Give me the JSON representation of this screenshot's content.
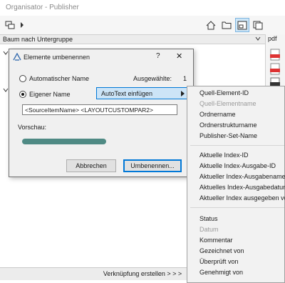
{
  "window": {
    "title": "Organisator - Publisher"
  },
  "toolbar": {
    "icons": [
      "publisher-set-icon",
      "house-icon",
      "folder-icon",
      "layout-icon",
      "copy-icon"
    ]
  },
  "group_bar": {
    "label": "Baum nach Untergruppe",
    "pdf_label": "pdf"
  },
  "bottom_bar": {
    "label": "Verknüpfung erstellen > > >"
  },
  "dialog": {
    "title": "Elemente umbenennen",
    "help": "?",
    "close": "✕",
    "auto_name_label": "Automatischer Name",
    "selected_label": "Ausgewählte:",
    "selected_count": "1",
    "custom_name_label": "Eigener Name",
    "autotext_button": "AutoText einfügen",
    "name_value": "<SourceItemName> <LAYOUTCUSTOMPAR2>",
    "preview_label": "Vorschau:",
    "cancel_button": "Abbrechen",
    "rename_button": "Umbenennen..."
  },
  "menu": {
    "group1": [
      {
        "label": "Quell-Element-ID",
        "enabled": true
      },
      {
        "label": "Quell-Elementname",
        "enabled": false
      },
      {
        "label": "Ordnername",
        "enabled": true
      },
      {
        "label": "Ordnerstrukturname",
        "enabled": true
      },
      {
        "label": "Publisher-Set-Name",
        "enabled": true
      }
    ],
    "group2": [
      {
        "label": "Aktuelle Index-ID",
        "enabled": true
      },
      {
        "label": "Aktuelle Index-Ausgabe-ID",
        "enabled": true
      },
      {
        "label": "Aktueller Index-Ausgabename",
        "enabled": true
      },
      {
        "label": "Aktuelles Index-Ausgabedatum",
        "enabled": true
      },
      {
        "label": "Aktueller Index ausgegeben von",
        "enabled": true
      }
    ],
    "group3": [
      {
        "label": "Status",
        "enabled": true
      },
      {
        "label": "Datum",
        "enabled": false
      },
      {
        "label": "Kommentar",
        "enabled": true
      },
      {
        "label": "Gezeichnet von",
        "enabled": true
      },
      {
        "label": "Überprüft von",
        "enabled": true
      },
      {
        "label": "Genehmigt von",
        "enabled": true
      }
    ]
  },
  "colors": {
    "accent": "#0078d7",
    "preview": "#4f8a84",
    "selected_tool": "#cde6f7"
  }
}
